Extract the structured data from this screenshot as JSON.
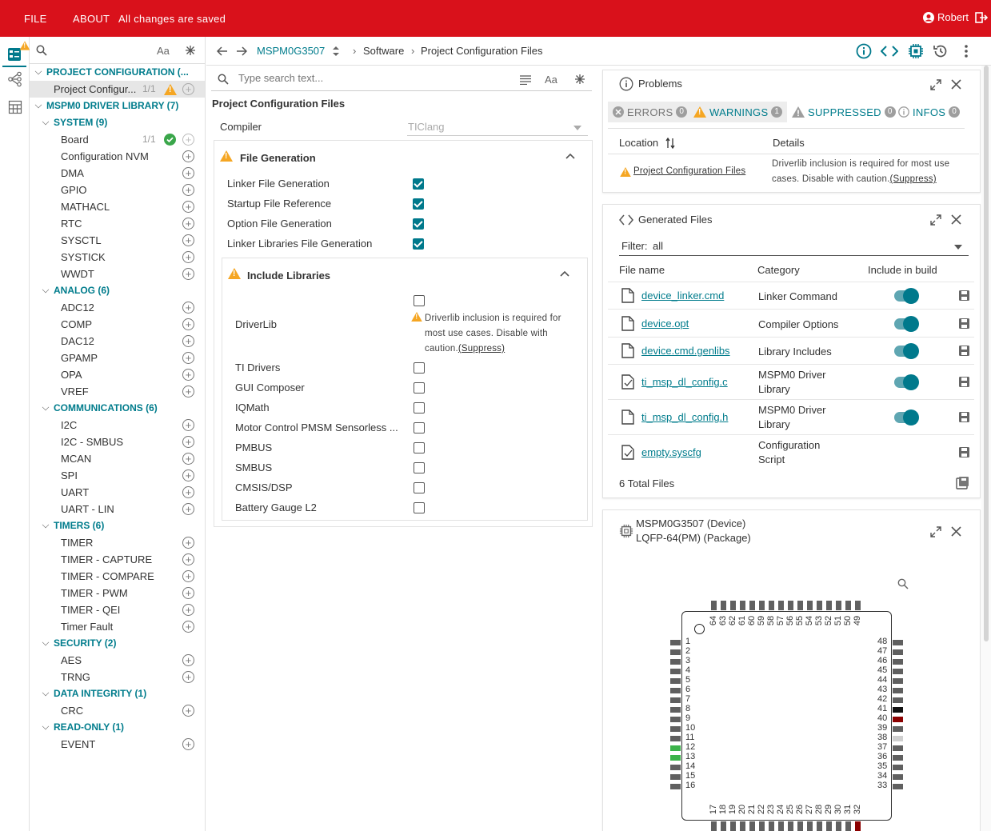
{
  "topbar": {
    "file": "FILE",
    "about": "ABOUT",
    "status": "All changes are saved",
    "user": "Robert"
  },
  "sidebar": {
    "search_placeholder": "",
    "aa": "Aa",
    "project": {
      "label": "PROJECT CONFIGURATION (...",
      "item": "Project Configur...",
      "count": "1/1"
    },
    "driverlib": "MSPM0 DRIVER LIBRARY (7)",
    "groups": [
      {
        "label": "SYSTEM (9)",
        "items": [
          "Board",
          "Configuration NVM",
          "DMA",
          "GPIO",
          "MATHACL",
          "RTC",
          "SYSCTL",
          "SYSTICK",
          "WWDT"
        ]
      },
      {
        "label": "ANALOG (6)",
        "items": [
          "ADC12",
          "COMP",
          "DAC12",
          "GPAMP",
          "OPA",
          "VREF"
        ]
      },
      {
        "label": "COMMUNICATIONS (6)",
        "items": [
          "I2C",
          "I2C - SMBUS",
          "MCAN",
          "SPI",
          "UART",
          "UART - LIN"
        ]
      },
      {
        "label": "TIMERS (6)",
        "items": [
          "TIMER",
          "TIMER - CAPTURE",
          "TIMER - COMPARE",
          "TIMER - PWM",
          "TIMER - QEI",
          "Timer Fault"
        ]
      },
      {
        "label": "SECURITY (2)",
        "items": [
          "AES",
          "TRNG"
        ]
      },
      {
        "label": "DATA INTEGRITY (1)",
        "items": [
          "CRC"
        ]
      },
      {
        "label": "READ-ONLY (1)",
        "items": [
          "EVENT"
        ]
      }
    ],
    "board_count": "1/1"
  },
  "breadcrumb": {
    "device": "MSPM0G3507",
    "software": "Software",
    "page": "Project Configuration Files"
  },
  "center": {
    "search_placeholder": "Type search text...",
    "aa": "Aa",
    "title": "Project Configuration Files",
    "compiler_label": "Compiler",
    "compiler_value": "TIClang",
    "filegen": {
      "title": "File Generation",
      "items": [
        "Linker File Generation",
        "Startup File Reference",
        "Option File Generation",
        "Linker Libraries File Generation"
      ]
    },
    "include": {
      "title": "Include Libraries",
      "driverlib": "DriverLib",
      "driverlib_warn": "Driverlib inclusion is required for most use cases. Disable with caution.",
      "suppress": "(Suppress)",
      "items": [
        "TI Drivers",
        "GUI Composer",
        "IQMath",
        "Motor Control PMSM Sensorless ...",
        "PMBUS",
        "SMBUS",
        "CMSIS/DSP",
        "Battery Gauge L2"
      ]
    }
  },
  "problems": {
    "title": "Problems",
    "tabs": [
      {
        "label": "ERRORS",
        "count": "0"
      },
      {
        "label": "WARNINGS",
        "count": "1"
      },
      {
        "label": "SUPPRESSED",
        "count": "0"
      },
      {
        "label": "INFOS",
        "count": "0"
      }
    ],
    "col_location": "Location",
    "col_details": "Details",
    "row": {
      "location": "Project Configuration Files",
      "details": "Driverlib inclusion is required for most use cases. Disable with caution.",
      "suppress": "(Suppress)"
    }
  },
  "generated": {
    "title": "Generated Files",
    "filter_label": "Filter:",
    "filter_value": "all",
    "col_name": "File name",
    "col_category": "Category",
    "col_include": "Include in build",
    "files": [
      {
        "name": "device_linker.cmd",
        "category": "Linker Command",
        "include": true
      },
      {
        "name": "device.opt",
        "category": "Compiler Options",
        "include": true
      },
      {
        "name": "device.cmd.genlibs",
        "category": "Library Includes",
        "include": true
      },
      {
        "name": "ti_msp_dl_config.c",
        "category": "MSPM0 Driver Library",
        "include": true
      },
      {
        "name": "ti_msp_dl_config.h",
        "category": "MSPM0 Driver Library",
        "include": true
      },
      {
        "name": "empty.syscfg",
        "category": "Configuration Script",
        "include": false
      }
    ],
    "total": "6 Total Files"
  },
  "device": {
    "line1": "MSPM0G3507 (Device)",
    "line2": "LQFP-64(PM) (Package)",
    "left_pins": [
      "1",
      "2",
      "3",
      "4",
      "5",
      "6",
      "7",
      "8",
      "9",
      "10",
      "11",
      "12",
      "13",
      "14",
      "15",
      "16"
    ],
    "bottom_pins": [
      "17",
      "18",
      "19",
      "20",
      "21",
      "22",
      "23",
      "24",
      "25",
      "26",
      "27",
      "28",
      "29",
      "30",
      "31",
      "32"
    ],
    "right_pins": [
      "48",
      "47",
      "46",
      "45",
      "44",
      "43",
      "42",
      "41",
      "40",
      "39",
      "38",
      "37",
      "36",
      "35",
      "34",
      "33"
    ],
    "top_pins": [
      "64",
      "63",
      "62",
      "61",
      "60",
      "59",
      "58",
      "57",
      "56",
      "55",
      "54",
      "53",
      "52",
      "51",
      "50",
      "49"
    ],
    "colors": {
      "pin": "#606060",
      "green": "#3cb34a",
      "black": "#111111",
      "darkred": "#8b0000",
      "light": "#cfcfcf"
    }
  }
}
